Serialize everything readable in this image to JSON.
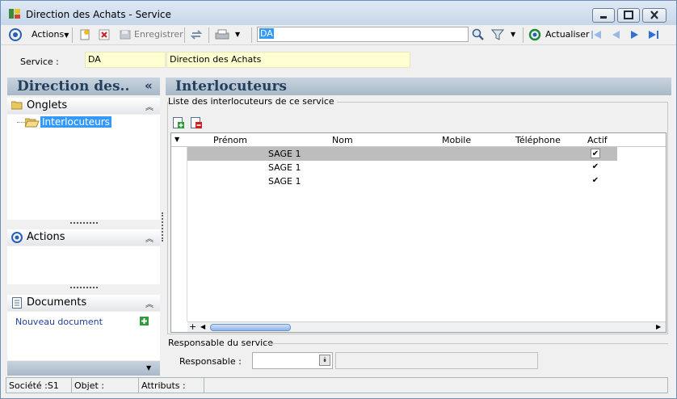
{
  "window": {
    "title": "Direction des Achats -  Service"
  },
  "toolbar": {
    "actions_label": "Actions",
    "save_label": "Enregistrer",
    "search_value": "DA",
    "refresh_label": "Actualiser"
  },
  "service": {
    "label": "Service :",
    "code": "DA",
    "name": "Direction des Achats"
  },
  "left_panel": {
    "header": "Direction des..",
    "onglets_title": "Onglets",
    "onglets_items": [
      "Interlocuteurs"
    ],
    "actions_title": "Actions",
    "documents_title": "Documents",
    "new_document_label": "Nouveau document"
  },
  "main": {
    "header": "Interlocuteurs",
    "list_group_label": "Liste des interlocuteurs de ce service",
    "columns": [
      "Prénom",
      "Nom",
      "Mobile",
      "Téléphone",
      "Actif"
    ],
    "rows": [
      {
        "prenom": "",
        "nom": "SAGE 1",
        "mobile": "",
        "telephone": "",
        "actif": true,
        "selected": true
      },
      {
        "prenom": "",
        "nom": "SAGE 1",
        "mobile": "",
        "telephone": "",
        "actif": true,
        "selected": false
      },
      {
        "prenom": "",
        "nom": "SAGE 1",
        "mobile": "",
        "telephone": "",
        "actif": true,
        "selected": false
      }
    ],
    "responsable_group_label": "Responsable du service",
    "responsable_label": "Responsable :",
    "responsable_value": ""
  },
  "statusbar": {
    "societe": "Société :S1",
    "objet": "Objet :",
    "attributs": "Attributs :"
  },
  "colors": {
    "header_text": "#233f5d",
    "selection": "#3399ff",
    "yellow_field": "#ffffd1",
    "link": "#1f3f9f"
  }
}
